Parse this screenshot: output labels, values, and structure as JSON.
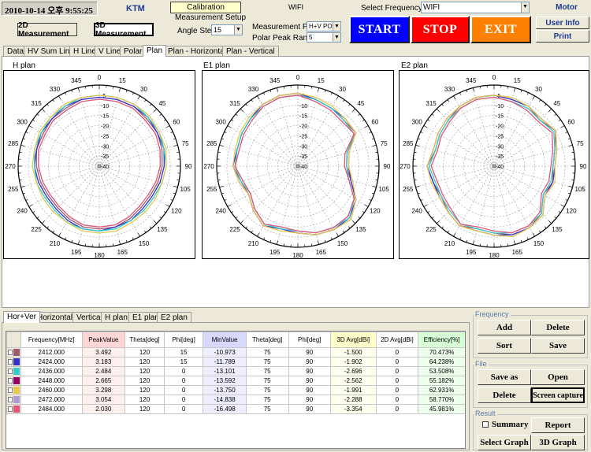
{
  "top": {
    "datetime": "2010-10-14 오후 9:55:25",
    "company": "KTM",
    "calibration_label": "Calibration",
    "wifi_label": "WIFI",
    "select_frequency_label": "Select Frequency",
    "frequency_value": "WIFI",
    "motor_label": "Motor",
    "user_info_label": "User Info",
    "print_label": "Print",
    "measurement_2d_label": "2D Measurement",
    "measurement_3d_label": "3D Measurement",
    "measurement_setup_label": "Measurement  Setup",
    "angle_step_label": "Angle Step",
    "angle_step_value": "15",
    "measurement_pol_label": "Measurement Pol",
    "measurement_pol_value": "H+V POL",
    "polar_peak_range_label": "Polar Peak Range",
    "polar_peak_range_value": "5",
    "start_label": "START",
    "stop_label": "STOP",
    "exit_label": "EXIT",
    "colors": {
      "start": "#0000ff",
      "stop": "#ff0000",
      "exit": "#ff8000"
    }
  },
  "main_tabs": [
    "Data",
    "HV Sum Line",
    "H Line",
    "V Line",
    "Polar",
    "Plan",
    "Plan - Horizontal",
    "Plan - Vertical"
  ],
  "main_tab_active": "Plan",
  "bottom_tabs": [
    "Hor+Ver",
    "Horizontal",
    "Vertical",
    "H plan",
    "E1 plan",
    "E2 plan"
  ],
  "bottom_tab_active": "Hor+Ver",
  "table": {
    "headers": [
      "Frequency[MHz]",
      "PeakValue",
      "Theta[deg]",
      "Phi[deg]",
      "MinValue",
      "Theta[deg]",
      "Phi[deg]",
      "3D Avg[dBi]",
      "2D Avg[dBi]",
      "Efficiency[%]"
    ],
    "header_colors": [
      "#ffffff",
      "#ffd6d6",
      "#ffffff",
      "#ffffff",
      "#d8d8ff",
      "#ffffff",
      "#ffffff",
      "#ffffcc",
      "#ffffff",
      "#d6ffd6"
    ],
    "rows": [
      {
        "color": "#9c5a6e",
        "cells": [
          "2412.000",
          "3.492",
          "120",
          "15",
          "-10.973",
          "75",
          "90",
          "-1.500",
          "0",
          "70.473%"
        ]
      },
      {
        "color": "#3333cc",
        "cells": [
          "2424.000",
          "3.183",
          "120",
          "15",
          "-11.789",
          "75",
          "90",
          "-1.902",
          "0",
          "64.238%"
        ]
      },
      {
        "color": "#33cccc",
        "cells": [
          "2436.000",
          "2.484",
          "120",
          "0",
          "-13.101",
          "75",
          "90",
          "-2.696",
          "0",
          "53.508%"
        ]
      },
      {
        "color": "#990066",
        "cells": [
          "2448.000",
          "2.665",
          "120",
          "0",
          "-13.592",
          "75",
          "90",
          "-2.562",
          "0",
          "55.182%"
        ]
      },
      {
        "color": "#e6c84d",
        "cells": [
          "2460.000",
          "3.298",
          "120",
          "0",
          "-13.750",
          "75",
          "90",
          "-1.991",
          "0",
          "62.931%"
        ]
      },
      {
        "color": "#b39ad6",
        "cells": [
          "2472.000",
          "3.054",
          "120",
          "0",
          "-14.838",
          "75",
          "90",
          "-2.288",
          "0",
          "58.770%"
        ]
      },
      {
        "color": "#e05578",
        "cells": [
          "2484.000",
          "2.030",
          "120",
          "0",
          "-16.498",
          "75",
          "90",
          "-3.354",
          "0",
          "45.981%"
        ]
      }
    ]
  },
  "right_panel": {
    "frequency_group": "Frequency",
    "add_label": "Add",
    "delete_label": "Delete",
    "sort_label": "Sort",
    "save_label": "Save",
    "file_group": "File",
    "save_as_label": "Save as",
    "open_label": "Open",
    "file_delete_label": "Delete",
    "screen_capture_label": "Screen capture",
    "result_group": "Result",
    "summary_label": "Summary",
    "report_label": "Report",
    "select_graph_label": "Select Graph",
    "graph_3d_label": "3D Graph"
  },
  "chart_data": [
    {
      "type": "polar",
      "title": "H plan",
      "angle_ticks": [
        "0",
        "15",
        "30",
        "45",
        "60",
        "75",
        "90",
        "105",
        "120",
        "135",
        "150",
        "165",
        "180",
        "195",
        "210",
        "225",
        "240",
        "255",
        "270",
        "285",
        "300",
        "315",
        "330",
        "345"
      ],
      "radial_ticks": [
        "-5",
        "-10",
        "-15",
        "-20",
        "-25",
        "-30",
        "-35",
        "-40"
      ],
      "rlim": [
        -40,
        0
      ],
      "series": [
        {
          "color": "#9c5a6e",
          "values": [
            -6,
            -6,
            -6,
            -7,
            -7,
            -8,
            -9,
            -10,
            -11,
            -11,
            -10,
            -9,
            -9,
            -9,
            -10,
            -11,
            -11,
            -10,
            -9,
            -8,
            -8,
            -7,
            -7,
            -6
          ]
        },
        {
          "color": "#3333cc",
          "values": [
            -6,
            -6,
            -6,
            -6,
            -7,
            -7,
            -8,
            -9,
            -10,
            -10,
            -9,
            -9,
            -8,
            -8,
            -9,
            -10,
            -10,
            -9,
            -8,
            -8,
            -7,
            -7,
            -6,
            -6
          ]
        },
        {
          "color": "#33cccc",
          "values": [
            -5,
            -5,
            -5,
            -6,
            -6,
            -7,
            -7,
            -8,
            -9,
            -9,
            -9,
            -8,
            -8,
            -8,
            -8,
            -9,
            -9,
            -8,
            -8,
            -7,
            -7,
            -6,
            -6,
            -5
          ]
        },
        {
          "color": "#e6c84d",
          "values": [
            -5,
            -5,
            -5,
            -5,
            -6,
            -6,
            -7,
            -8,
            -8,
            -8,
            -8,
            -7,
            -7,
            -7,
            -8,
            -8,
            -8,
            -8,
            -7,
            -7,
            -6,
            -6,
            -5,
            -5
          ]
        },
        {
          "color": "#e05578",
          "values": [
            -7,
            -7,
            -7,
            -8,
            -8,
            -9,
            -10,
            -11,
            -12,
            -12,
            -11,
            -10,
            -10,
            -10,
            -11,
            -12,
            -12,
            -11,
            -10,
            -9,
            -9,
            -8,
            -8,
            -7
          ]
        }
      ]
    },
    {
      "type": "polar",
      "title": "E1 plan",
      "angle_ticks": [
        "0",
        "15",
        "30",
        "45",
        "60",
        "75",
        "90",
        "105",
        "120",
        "135",
        "150",
        "165",
        "180",
        "195",
        "210",
        "225",
        "240",
        "255",
        "270",
        "285",
        "300",
        "315",
        "330",
        "345"
      ],
      "radial_ticks": [
        "-5",
        "-10",
        "-15",
        "-20",
        "-25",
        "-30",
        "-35",
        "-40"
      ],
      "rlim": [
        -40,
        0
      ],
      "series": [
        {
          "color": "#9c5a6e",
          "values": [
            -4,
            -6,
            -7,
            -8,
            -7,
            -15,
            -16,
            -13,
            -7,
            -3,
            -4,
            -5,
            -7,
            -8,
            -6,
            -9,
            -12,
            -11,
            -8,
            -9,
            -8,
            -7,
            -5,
            -4
          ]
        },
        {
          "color": "#3333cc",
          "values": [
            -4,
            -6,
            -7,
            -7,
            -7,
            -14,
            -15,
            -13,
            -7,
            -4,
            -4,
            -5,
            -7,
            -8,
            -6,
            -9,
            -12,
            -10,
            -8,
            -9,
            -8,
            -7,
            -5,
            -4
          ]
        },
        {
          "color": "#33cccc",
          "values": [
            -5,
            -6,
            -7,
            -8,
            -8,
            -15,
            -16,
            -14,
            -8,
            -4,
            -5,
            -6,
            -8,
            -8,
            -7,
            -10,
            -13,
            -11,
            -9,
            -9,
            -8,
            -7,
            -6,
            -5
          ]
        },
        {
          "color": "#e6c84d",
          "values": [
            -4,
            -5,
            -6,
            -7,
            -7,
            -14,
            -15,
            -12,
            -7,
            -3,
            -4,
            -5,
            -7,
            -7,
            -6,
            -9,
            -12,
            -10,
            -8,
            -8,
            -7,
            -6,
            -5,
            -4
          ]
        },
        {
          "color": "#e05578",
          "values": [
            -5,
            -7,
            -8,
            -9,
            -8,
            -16,
            -17,
            -14,
            -8,
            -5,
            -5,
            -6,
            -8,
            -9,
            -7,
            -10,
            -13,
            -12,
            -9,
            -10,
            -9,
            -8,
            -6,
            -5
          ]
        }
      ]
    },
    {
      "type": "polar",
      "title": "E2 plan",
      "angle_ticks": [
        "0",
        "15",
        "30",
        "45",
        "60",
        "75",
        "90",
        "105",
        "120",
        "135",
        "150",
        "165",
        "180",
        "195",
        "210",
        "225",
        "240",
        "255",
        "270",
        "285",
        "300",
        "315",
        "330",
        "345"
      ],
      "radial_ticks": [
        "-5",
        "-10",
        "-15",
        "-20",
        "-25",
        "-30",
        "-35",
        "-40"
      ],
      "rlim": [
        -40,
        0
      ],
      "series": [
        {
          "color": "#9c5a6e",
          "values": [
            -5,
            -6,
            -6,
            -8,
            -5,
            -9,
            -11,
            -10,
            -12,
            -7,
            -5,
            -5,
            -7,
            -8,
            -6,
            -8,
            -10,
            -9,
            -7,
            -10,
            -9,
            -8,
            -6,
            -5
          ]
        },
        {
          "color": "#3333cc",
          "values": [
            -5,
            -6,
            -6,
            -7,
            -5,
            -8,
            -10,
            -10,
            -11,
            -6,
            -5,
            -5,
            -6,
            -7,
            -6,
            -8,
            -9,
            -9,
            -7,
            -9,
            -8,
            -7,
            -6,
            -5
          ]
        },
        {
          "color": "#33cccc",
          "values": [
            -6,
            -7,
            -7,
            -8,
            -6,
            -9,
            -11,
            -11,
            -12,
            -7,
            -6,
            -6,
            -7,
            -8,
            -7,
            -9,
            -10,
            -10,
            -8,
            -10,
            -9,
            -8,
            -7,
            -6
          ]
        },
        {
          "color": "#e6c84d",
          "values": [
            -5,
            -5,
            -6,
            -7,
            -5,
            -8,
            -10,
            -9,
            -11,
            -6,
            -5,
            -4,
            -6,
            -7,
            -6,
            -8,
            -9,
            -8,
            -7,
            -9,
            -8,
            -7,
            -6,
            -5
          ]
        },
        {
          "color": "#e05578",
          "values": [
            -6,
            -7,
            -8,
            -9,
            -7,
            -10,
            -12,
            -12,
            -13,
            -8,
            -6,
            -6,
            -8,
            -9,
            -7,
            -10,
            -11,
            -11,
            -9,
            -11,
            -10,
            -9,
            -7,
            -6
          ]
        }
      ]
    }
  ]
}
